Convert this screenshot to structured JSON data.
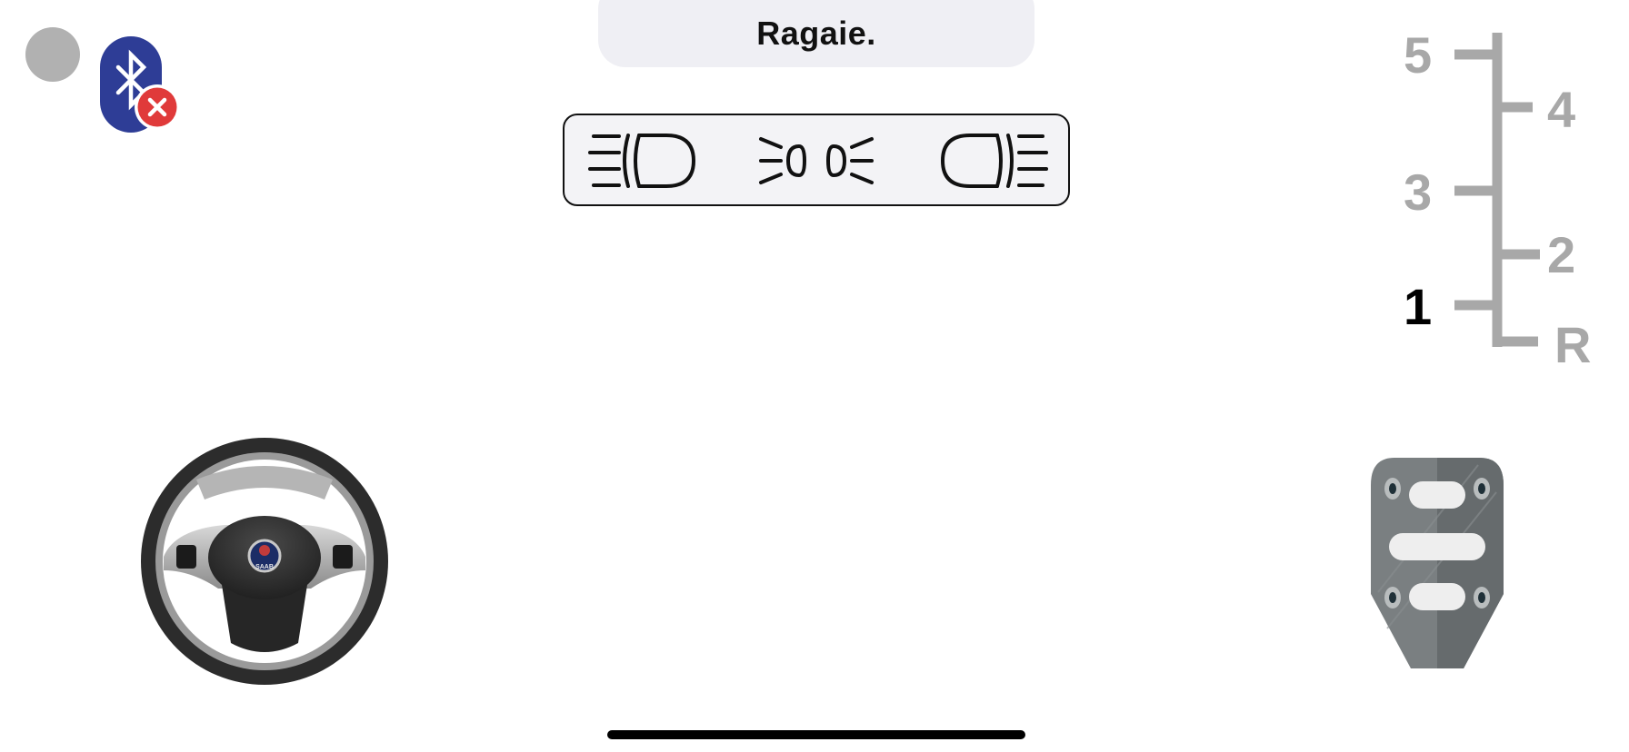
{
  "header": {
    "title": "Ragaie."
  },
  "status": {
    "indicator_color": "#b1b1b1",
    "bluetooth": {
      "icon": "bluetooth-icon",
      "state": "disconnected",
      "badge_icon": "close-icon",
      "color": "#2e3d96",
      "badge_color": "#e03a3a"
    }
  },
  "lights": {
    "items": [
      {
        "icon": "low-beam-headlight-icon"
      },
      {
        "icon": "parking-lights-icon"
      },
      {
        "icon": "high-beam-headlight-icon"
      }
    ]
  },
  "gearbox": {
    "gears": [
      "5",
      "4",
      "3",
      "2",
      "1",
      "R"
    ],
    "selected": "1",
    "active_color": "#000000",
    "inactive_color": "#a8a8a8"
  },
  "controls": {
    "steering_wheel": {
      "icon": "steering-wheel-icon",
      "badge_text": "SAAB"
    },
    "pedal": {
      "icon": "accelerator-pedal-icon"
    }
  }
}
